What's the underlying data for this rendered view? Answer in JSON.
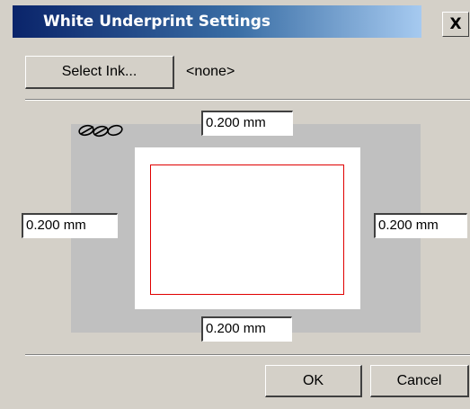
{
  "window": {
    "title": "White Underprint Settings",
    "close_glyph": "X"
  },
  "ink": {
    "select_button_label": "Select Ink...",
    "current_value": "<none>"
  },
  "margins": {
    "top": "0.200 mm",
    "left": "0.200 mm",
    "right": "0.200 mm",
    "bottom": "0.200 mm",
    "link_icon": "chain-link-icon",
    "margin_color": "#e00000"
  },
  "buttons": {
    "ok_label": "OK",
    "cancel_label": "Cancel"
  }
}
